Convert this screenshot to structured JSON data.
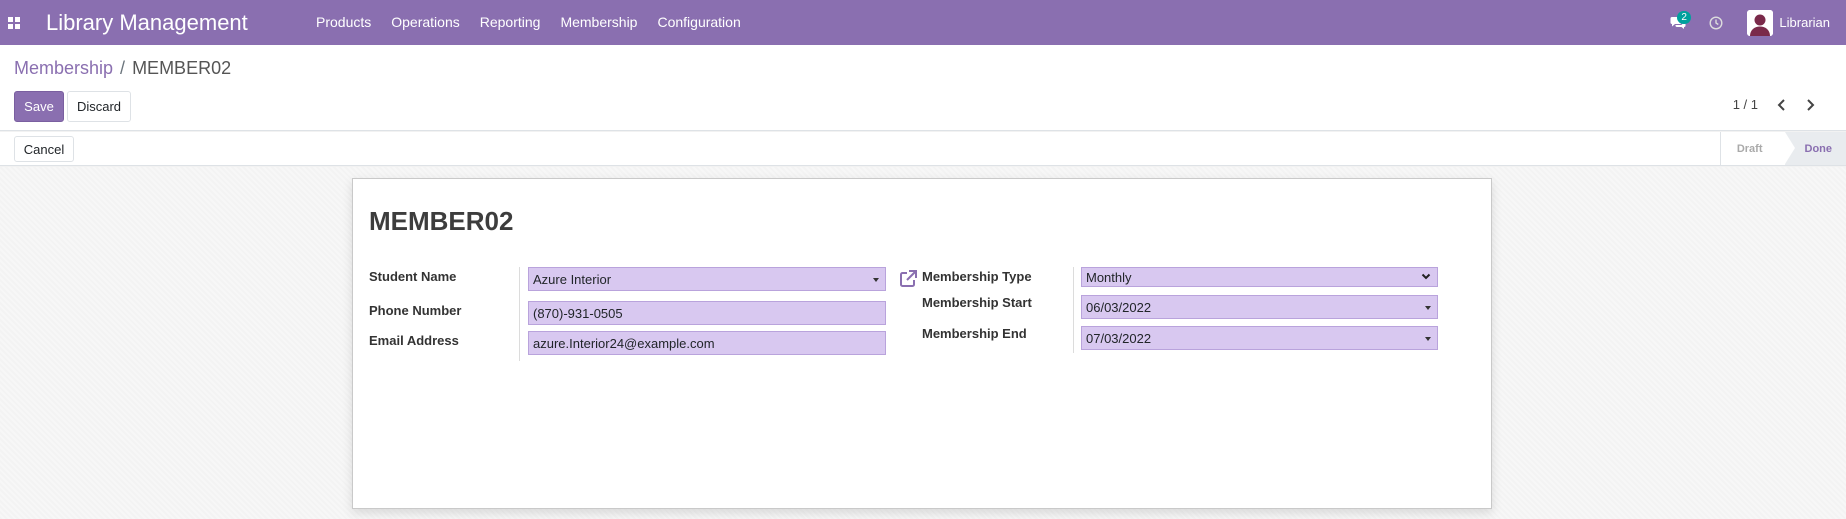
{
  "navbar": {
    "app_title": "Library Management",
    "menu": [
      "Products",
      "Operations",
      "Reporting",
      "Membership",
      "Configuration"
    ],
    "messages_count": "2",
    "user_name": "Librarian"
  },
  "breadcrumb": {
    "parent": "Membership",
    "separator": "/",
    "current": "MEMBER02"
  },
  "buttons": {
    "save": "Save",
    "discard": "Discard",
    "cancel": "Cancel"
  },
  "pager": {
    "value": "1 / 1"
  },
  "status_stages": [
    "Draft",
    "Done"
  ],
  "active_stage": "Done",
  "record": {
    "name": "MEMBER02",
    "student_name_label": "Student Name",
    "student_name": "Azure Interior",
    "phone_label": "Phone Number",
    "phone": "(870)-931-0505",
    "email_label": "Email Address",
    "email": "azure.Interior24@example.com",
    "membership_type_label": "Membership Type",
    "membership_type": "Monthly",
    "membership_start_label": "Membership Start",
    "membership_start": "06/03/2022",
    "membership_end_label": "Membership End",
    "membership_end": "07/03/2022"
  },
  "colors": {
    "brand": "#8a6fb0",
    "field_bg": "#d8c8f0",
    "badge": "#00a09d"
  }
}
